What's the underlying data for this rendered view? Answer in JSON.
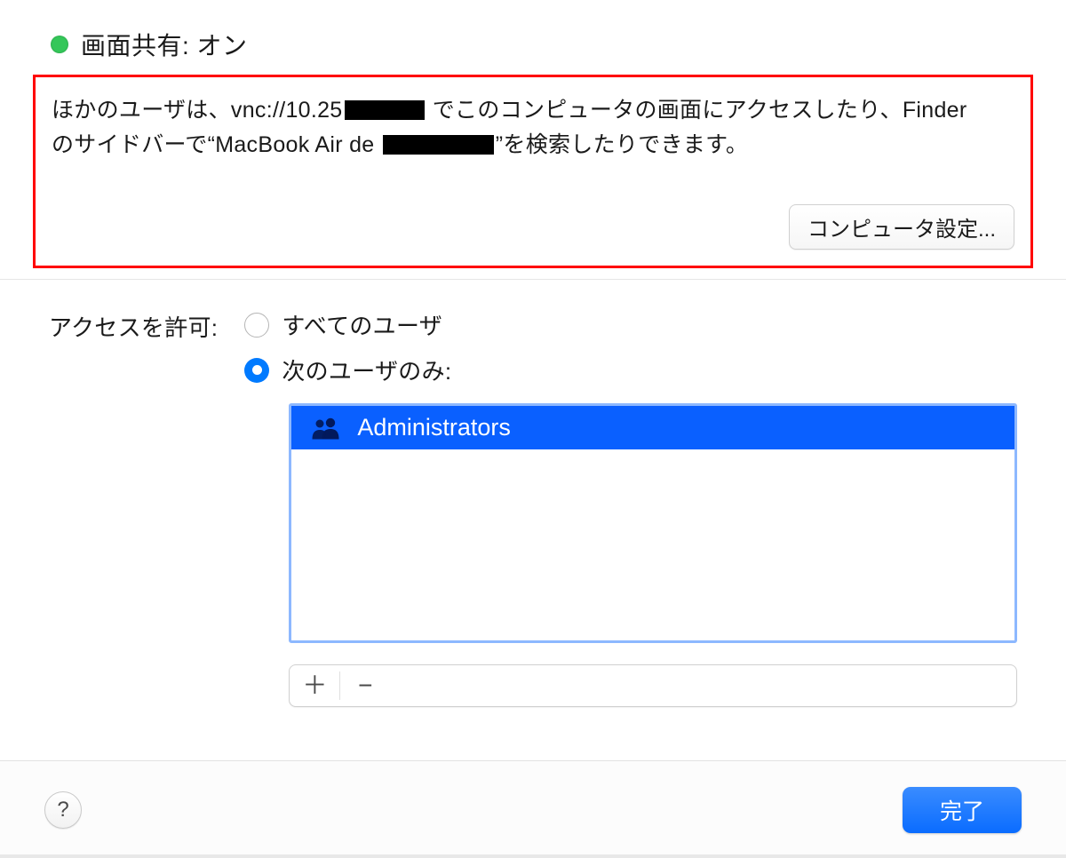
{
  "status": {
    "on": true,
    "title": "画面共有: オン"
  },
  "info": {
    "part1": "ほかのユーザは、vnc://10.25",
    "part2": " でこのコンピュータの画面にアクセスしたり、Finder",
    "part3": "のサイドバーで“MacBook Air de ",
    "part4": "”を検索したりできます。",
    "computer_settings_button": "コンピュータ設定..."
  },
  "access": {
    "label": "アクセスを許可:",
    "options": {
      "all_users": "すべてのユーザ",
      "only_these": "次のユーザのみ:"
    },
    "selected": "only_these",
    "users": [
      {
        "name": "Administrators"
      }
    ]
  },
  "buttons": {
    "add": "＋",
    "remove": "−",
    "help": "?",
    "done": "完了"
  },
  "colors": {
    "accent": "#007aff",
    "status_on": "#34c759",
    "highlight_border": "#ff0000",
    "selection_bg": "#0a60ff"
  }
}
